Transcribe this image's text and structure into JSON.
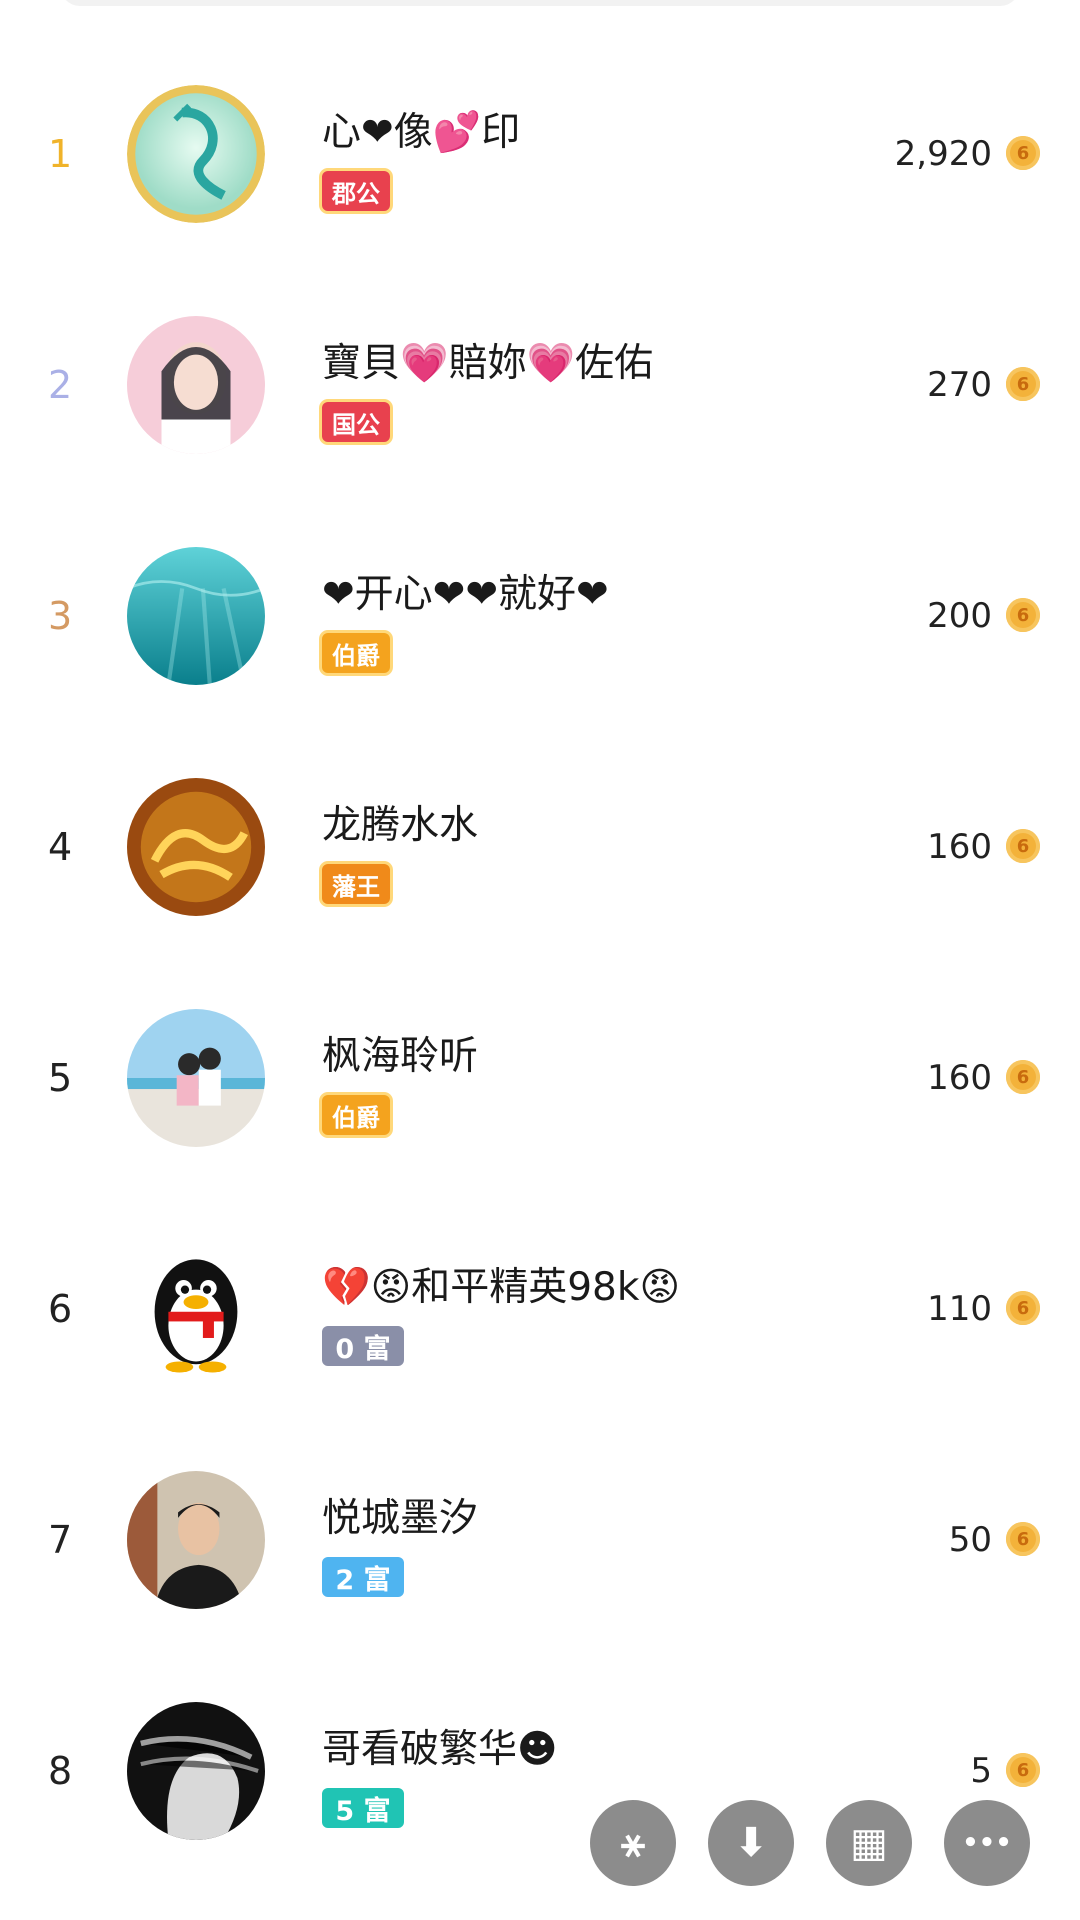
{
  "leaderboard": [
    {
      "rank": "1",
      "name": "心❤像💕印",
      "badge": "郡公",
      "badge_type": "noble",
      "badge_color": "#e8414e",
      "amount": "2,920",
      "rank_color": "#f0b32a",
      "avatar": "dragon-avatar"
    },
    {
      "rank": "2",
      "name": "寶貝💗賠妳💗佐佑",
      "badge": "国公",
      "badge_type": "noble",
      "badge_color": "#e8414e",
      "amount": "270",
      "rank_color": "#aab0e6",
      "avatar": "girl-avatar"
    },
    {
      "rank": "3",
      "name": "❤开心❤❤就好❤",
      "badge": "伯爵",
      "badge_type": "noble",
      "badge_color": "#f4a31e",
      "amount": "200",
      "rank_color": "#d49a63",
      "avatar": "ocean-avatar"
    },
    {
      "rank": "4",
      "name": "龙腾水水",
      "badge": "藩王",
      "badge_type": "noble",
      "badge_color": "#f08a1a",
      "amount": "160",
      "rank_color": "#222222",
      "avatar": "golden-dragon-avatar"
    },
    {
      "rank": "5",
      "name": "枫海聆听",
      "badge": "伯爵",
      "badge_type": "noble",
      "badge_color": "#f4a31e",
      "amount": "160",
      "rank_color": "#222222",
      "avatar": "couple-beach-avatar"
    },
    {
      "rank": "6",
      "name": "💔😡和平精英98k😡",
      "badge": "0 富",
      "badge_type": "wealth",
      "badge_color": "#8a8fa8",
      "amount": "110",
      "rank_color": "#222222",
      "avatar": "qq-penguin-avatar"
    },
    {
      "rank": "7",
      "name": "悦城墨汐",
      "badge": "2 富",
      "badge_type": "wealth",
      "badge_color": "#4fb4f0",
      "amount": "50",
      "rank_color": "#222222",
      "avatar": "man-portrait-avatar"
    },
    {
      "rank": "8",
      "name": "哥看破繁华☻",
      "badge": "5 富",
      "badge_type": "wealth",
      "badge_color": "#20c4b4",
      "amount": "5",
      "rank_color": "#222222",
      "avatar": "bw-face-avatar"
    }
  ],
  "coin_glyph": "6",
  "fab_buttons": [
    {
      "name": "share-icon",
      "glyph": "⚹"
    },
    {
      "name": "download-icon",
      "glyph": "⬇"
    },
    {
      "name": "grid-icon",
      "glyph": "▦"
    },
    {
      "name": "more-icon",
      "glyph": "•••"
    }
  ]
}
